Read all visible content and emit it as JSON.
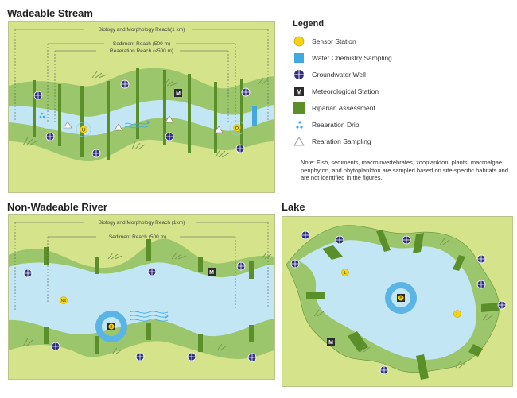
{
  "panels": {
    "wadeable_stream": {
      "title": "Wadeable Stream",
      "reaches": {
        "biology": "Biology and Morphology Reach(1 km)",
        "sediment": "Sediment Reach (500 m)",
        "reaeration": "Reaeration Reach (≤500 m)"
      },
      "sensor_labels": {
        "upstream": "U",
        "downstream": "D"
      },
      "met_label": "M"
    },
    "non_wadeable_river": {
      "title": "Non-Wadeable River",
      "reaches": {
        "biology": "Biology and Morphology Reach (1km)",
        "sediment": "Sediment Reach (500 m)"
      },
      "sensor_labels": {
        "nearshore": "NS",
        "buoy": "B"
      },
      "met_label": "M"
    },
    "lake": {
      "title": "Lake",
      "sensor_labels": {
        "littoral": "L",
        "buoy": "B"
      },
      "met_label": "M"
    }
  },
  "legend": {
    "title": "Legend",
    "items": [
      {
        "icon": "sensor-station-icon",
        "label": "Sensor Station"
      },
      {
        "icon": "water-chemistry-icon",
        "label": "Water Chemistry Sampling"
      },
      {
        "icon": "groundwater-well-icon",
        "label": "Groundwater Well"
      },
      {
        "icon": "meteorological-station-icon",
        "label": "Meteorological Station"
      },
      {
        "icon": "riparian-assessment-icon",
        "label": "Riparian Assessment"
      },
      {
        "icon": "reaeration-drip-icon",
        "label": "Reaeration Drip"
      },
      {
        "icon": "rearation-sampling-icon",
        "label": "Rearation Sampling"
      }
    ],
    "met_symbol": "M"
  },
  "note": "Note: Fish, sediments, macroinvertebrates, zooplankton, plants, macroalgae, periphyton, and phytoplankton are sampled based on site-specific habitats and are not identified in the figures.",
  "colors": {
    "upland": "#d5e48b",
    "riparian": "#9cc66b",
    "riparian_bar": "#5a8f29",
    "water": "#c3e6f5",
    "water_chem": "#3fa9e0",
    "well": "#2e2f7f",
    "sensor": "#f6d40f",
    "met": "#2b2b2b"
  }
}
